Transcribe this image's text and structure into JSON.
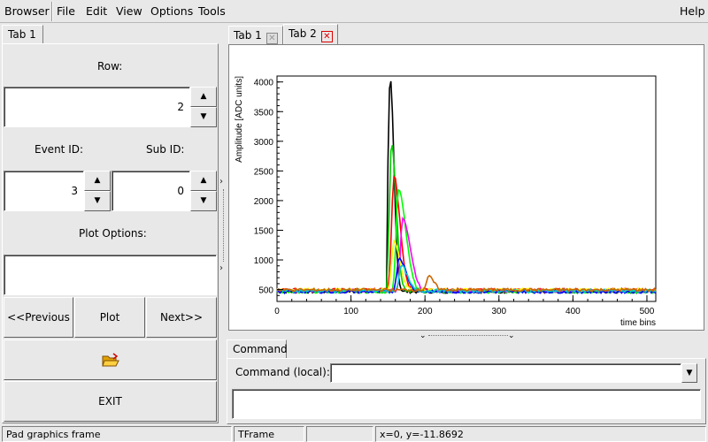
{
  "menu": {
    "browser": "Browser",
    "file": "File",
    "edit": "Edit",
    "view": "View",
    "options": "Options",
    "tools": "Tools",
    "help": "Help"
  },
  "left_tab": {
    "label": "Tab 1"
  },
  "controls": {
    "row_label": "Row:",
    "row_value": "2",
    "event_id_label": "Event ID:",
    "event_id_value": "3",
    "sub_id_label": "Sub ID:",
    "sub_id_value": "0",
    "plot_options_label": "Plot Options:",
    "plot_options_value": "",
    "previous_label": "<<Previous",
    "plot_label": "Plot",
    "next_label": "Next>>",
    "open_icon": "folder-open-icon",
    "exit_label": "EXIT"
  },
  "right_tabs": [
    {
      "label": "Tab 1"
    },
    {
      "label": "Tab 2"
    }
  ],
  "command": {
    "tab_label": "Command",
    "local_label": "Command (local):",
    "value": ""
  },
  "status": {
    "left": "Pad graphics frame",
    "mid": "TFrame",
    "blank": "",
    "coords": "x=0, y=-11.8692"
  },
  "chart_data": {
    "type": "line",
    "title": "",
    "xlabel": "time bins",
    "ylabel": "Amplitude [ADC units]",
    "xlim": [
      0,
      512
    ],
    "ylim": [
      300,
      4100
    ],
    "x_ticks": [
      0,
      100,
      200,
      300,
      400,
      500
    ],
    "y_ticks": [
      500,
      1000,
      1500,
      2000,
      2500,
      3000,
      3500,
      4000
    ],
    "baseline": 480,
    "pulse_start": 150,
    "series": [
      {
        "color": "#000000",
        "peak": 4080,
        "peak_bin": 153,
        "width": 5
      },
      {
        "color": "#00cc00",
        "peak": 2950,
        "peak_bin": 155,
        "width": 6
      },
      {
        "color": "#ff0000",
        "peak": 2400,
        "peak_bin": 158,
        "width": 8
      },
      {
        "color": "#00ff00",
        "peak": 2200,
        "peak_bin": 164,
        "width": 10
      },
      {
        "color": "#ff00ff",
        "peak": 1700,
        "peak_bin": 170,
        "width": 10
      },
      {
        "color": "#ffff00",
        "peak": 1300,
        "peak_bin": 158,
        "width": 8
      },
      {
        "color": "#0000ff",
        "peak": 1050,
        "peak_bin": 165,
        "width": 9
      },
      {
        "color": "#00cccc",
        "peak": 900,
        "peak_bin": 168,
        "width": 8
      },
      {
        "color": "#cc6600",
        "peak": 700,
        "peak_bin": 205,
        "width": 7
      }
    ]
  }
}
